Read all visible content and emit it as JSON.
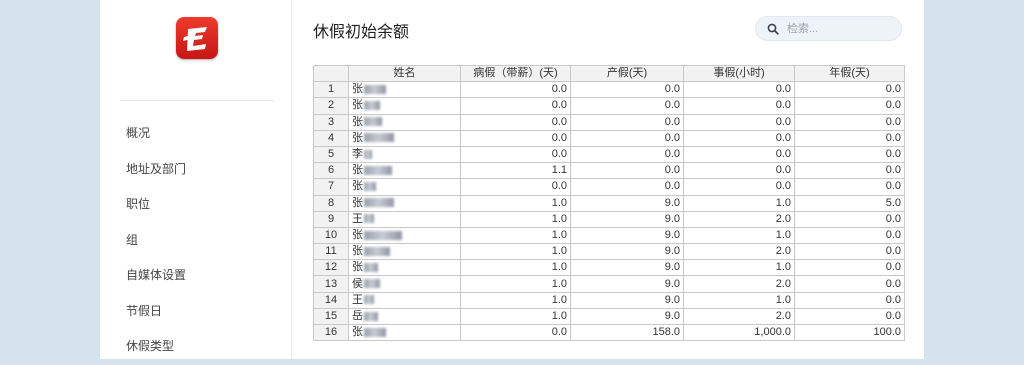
{
  "app": {
    "accent": "#d62a20",
    "background": "#d6e2ec"
  },
  "logo": {
    "name": "app-logo"
  },
  "sidebar": {
    "items": [
      {
        "label": "概况"
      },
      {
        "label": "地址及部门"
      },
      {
        "label": "职位"
      },
      {
        "label": "组"
      },
      {
        "label": "自媒体设置"
      },
      {
        "label": "节假日"
      },
      {
        "label": "休假类型"
      }
    ]
  },
  "page": {
    "title": "休假初始余额"
  },
  "search": {
    "placeholder": "检索...",
    "icon": "search-icon"
  },
  "table": {
    "headers": [
      "",
      "姓名",
      "病假（带薪）(天)",
      "产假(天)",
      "事假(小时)",
      "年假(天)"
    ],
    "rows": [
      {
        "idx": "1",
        "name": "张",
        "sick": "0.0",
        "maternity": "0.0",
        "personal": "0.0",
        "annual": "0.0"
      },
      {
        "idx": "2",
        "name": "张",
        "sick": "0.0",
        "maternity": "0.0",
        "personal": "0.0",
        "annual": "0.0"
      },
      {
        "idx": "3",
        "name": "张",
        "sick": "0.0",
        "maternity": "0.0",
        "personal": "0.0",
        "annual": "0.0"
      },
      {
        "idx": "4",
        "name": "张",
        "sick": "0.0",
        "maternity": "0.0",
        "personal": "0.0",
        "annual": "0.0"
      },
      {
        "idx": "5",
        "name": "李",
        "sick": "0.0",
        "maternity": "0.0",
        "personal": "0.0",
        "annual": "0.0"
      },
      {
        "idx": "6",
        "name": "张",
        "sick": "1.1",
        "maternity": "0.0",
        "personal": "0.0",
        "annual": "0.0"
      },
      {
        "idx": "7",
        "name": "张",
        "sick": "0.0",
        "maternity": "0.0",
        "personal": "0.0",
        "annual": "0.0"
      },
      {
        "idx": "8",
        "name": "张",
        "sick": "1.0",
        "maternity": "9.0",
        "personal": "1.0",
        "annual": "5.0"
      },
      {
        "idx": "9",
        "name": "王",
        "sick": "1.0",
        "maternity": "9.0",
        "personal": "2.0",
        "annual": "0.0"
      },
      {
        "idx": "10",
        "name": "张",
        "sick": "1.0",
        "maternity": "9.0",
        "personal": "1.0",
        "annual": "0.0"
      },
      {
        "idx": "11",
        "name": "张",
        "sick": "1.0",
        "maternity": "9.0",
        "personal": "2.0",
        "annual": "0.0"
      },
      {
        "idx": "12",
        "name": "张",
        "sick": "1.0",
        "maternity": "9.0",
        "personal": "1.0",
        "annual": "0.0"
      },
      {
        "idx": "13",
        "name": "侯",
        "sick": "1.0",
        "maternity": "9.0",
        "personal": "2.0",
        "annual": "0.0"
      },
      {
        "idx": "14",
        "name": "王",
        "sick": "1.0",
        "maternity": "9.0",
        "personal": "1.0",
        "annual": "0.0"
      },
      {
        "idx": "15",
        "name": "岳",
        "sick": "1.0",
        "maternity": "9.0",
        "personal": "2.0",
        "annual": "0.0"
      },
      {
        "idx": "16",
        "name": "张",
        "sick": "0.0",
        "maternity": "158.0",
        "personal": "1,000.0",
        "annual": "100.0"
      }
    ]
  }
}
